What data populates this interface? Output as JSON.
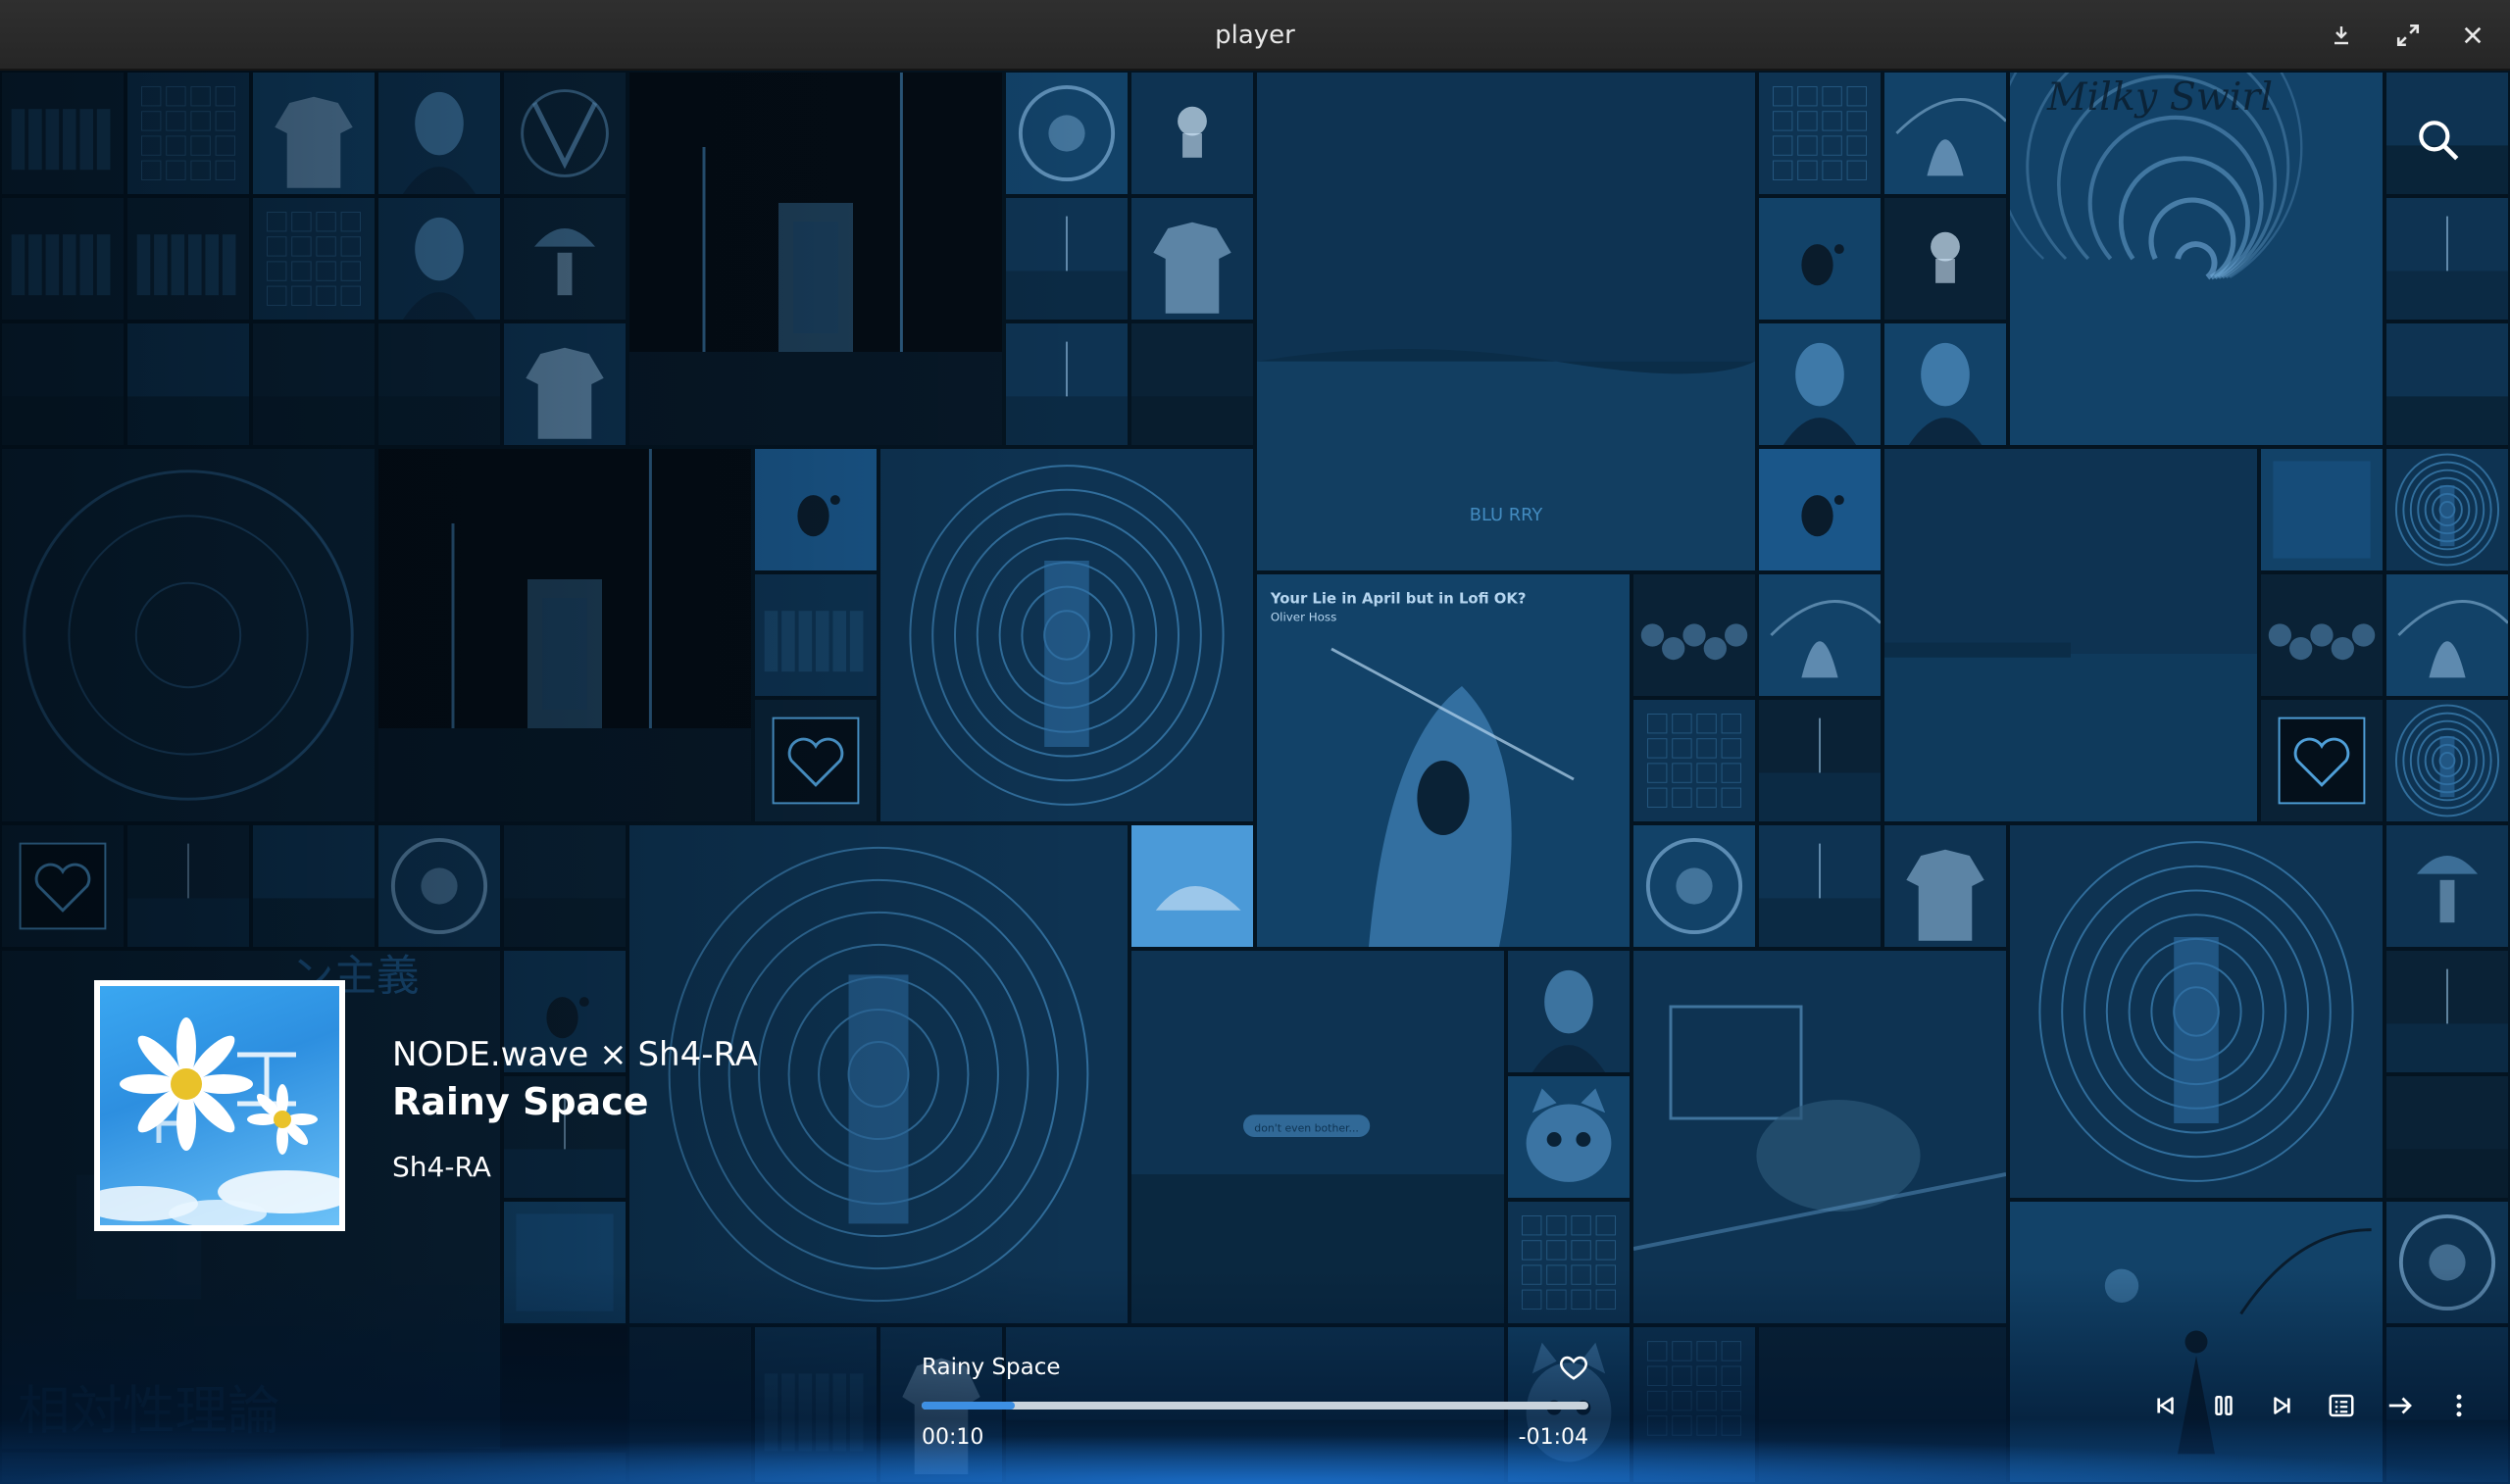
{
  "window": {
    "title": "player",
    "buttons": [
      "download-icon",
      "fullscreen-icon",
      "close-icon"
    ]
  },
  "mosaic": {
    "tile_texts": {
      "your_lie": "Your Lie in April but in Lofi OK?",
      "oliver": "Oliver Hoss",
      "milky": "Milky Swirl",
      "dont_even": "don't even bother...",
      "kanji_big": "相対性理論",
      "kanji_ism": "ン主義",
      "blurry": "BLU RRY"
    }
  },
  "now_playing": {
    "artists_line": "NODE.wave × Sh4-RA",
    "title": "Rainy Space",
    "artist": "Sh4-RA",
    "cover_icon": "daisy-cover-art"
  },
  "playback": {
    "track": "Rainy Space",
    "elapsed": "00:10",
    "remaining": "-01:04",
    "progress_fraction": 0.14,
    "heart_icon": "heart-icon"
  },
  "controls": [
    "previous-icon",
    "pause-icon",
    "next-icon",
    "queue-icon",
    "forward-arrow-icon",
    "more-icon"
  ],
  "colors": {
    "accent": "#3d8fe3",
    "tint": "#0f4c7a",
    "titlebar": "#2b2b2b"
  }
}
